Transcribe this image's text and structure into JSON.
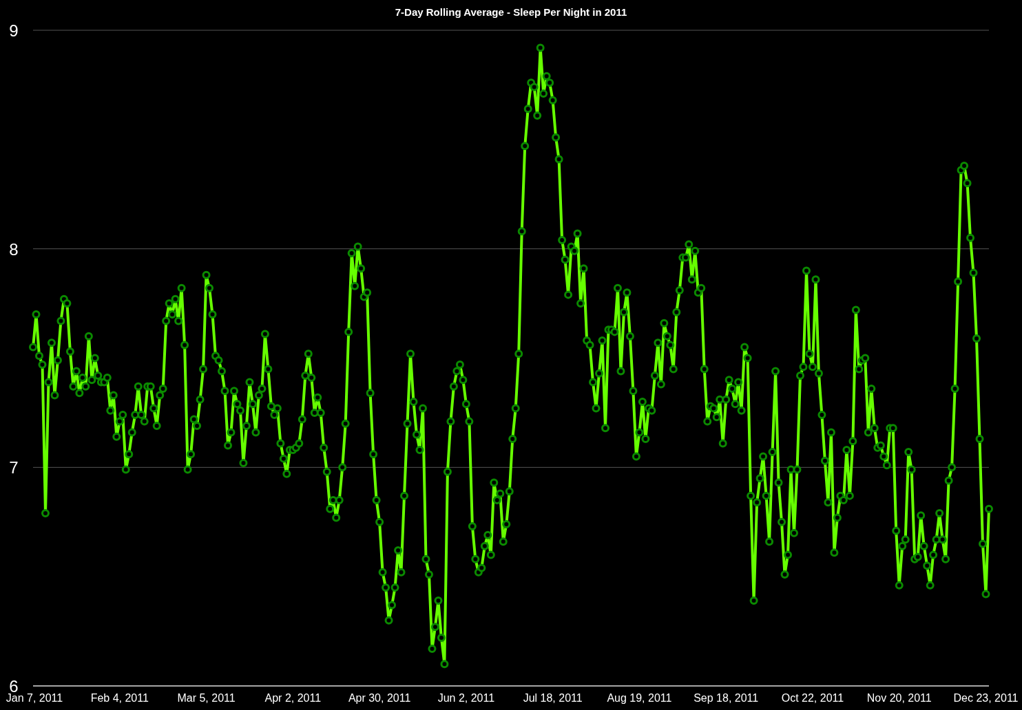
{
  "chart": {
    "chart_data": {
      "type": "line",
      "title": "7-Day Rolling Average - Sleep Per Night in 2011",
      "marker": "o",
      "ylim": [
        6,
        9
      ],
      "yticks": [
        6,
        7,
        8,
        9
      ],
      "categories": [
        "Jan 7, 2011",
        null,
        null,
        null,
        null,
        null,
        null,
        null,
        null,
        null,
        null,
        null,
        null,
        null,
        null,
        null,
        null,
        null,
        null,
        null,
        null,
        null,
        null,
        null,
        null,
        null,
        null,
        null,
        "Feb 4, 2011",
        null,
        null,
        null,
        null,
        null,
        null,
        null,
        null,
        null,
        null,
        null,
        null,
        null,
        null,
        null,
        null,
        null,
        null,
        null,
        null,
        null,
        null,
        null,
        null,
        null,
        null,
        null,
        "Mar 5, 2011",
        null,
        null,
        null,
        null,
        null,
        null,
        null,
        null,
        null,
        null,
        null,
        null,
        null,
        null,
        null,
        null,
        null,
        null,
        null,
        null,
        null,
        null,
        null,
        null,
        null,
        null,
        null,
        "Apr 2, 2011",
        null,
        null,
        null,
        null,
        null,
        null,
        null,
        null,
        null,
        null,
        null,
        null,
        null,
        null,
        null,
        null,
        null,
        null,
        null,
        null,
        null,
        null,
        null,
        null,
        null,
        null,
        null,
        "Apr 30, 2011",
        null,
        null,
        null,
        null,
        null,
        null,
        null,
        null,
        null,
        null,
        null,
        null,
        null,
        null,
        null,
        null,
        null,
        null,
        null,
        null,
        null,
        null,
        null,
        null,
        null,
        null,
        null,
        "Jun 2, 2011",
        null,
        null,
        null,
        null,
        null,
        null,
        null,
        null,
        null,
        null,
        null,
        null,
        null,
        null,
        null,
        null,
        null,
        null,
        null,
        null,
        null,
        null,
        null,
        null,
        null,
        null,
        null,
        "Jul 18, 2011",
        null,
        null,
        null,
        null,
        null,
        null,
        null,
        null,
        null,
        null,
        null,
        null,
        null,
        null,
        null,
        null,
        null,
        null,
        null,
        null,
        null,
        null,
        null,
        null,
        null,
        null,
        null,
        "Aug 19, 2011",
        null,
        null,
        null,
        null,
        null,
        null,
        null,
        null,
        null,
        null,
        null,
        null,
        null,
        null,
        null,
        null,
        null,
        null,
        null,
        null,
        null,
        null,
        null,
        null,
        null,
        null,
        null,
        "Sep 18, 2011",
        null,
        null,
        null,
        null,
        null,
        null,
        null,
        null,
        null,
        null,
        null,
        null,
        null,
        null,
        null,
        null,
        null,
        null,
        null,
        null,
        null,
        null,
        null,
        null,
        null,
        null,
        null,
        "Oct 22, 2011",
        null,
        null,
        null,
        null,
        null,
        null,
        null,
        null,
        null,
        null,
        null,
        null,
        null,
        null,
        null,
        null,
        null,
        null,
        null,
        null,
        null,
        null,
        null,
        null,
        null,
        null,
        null,
        "Nov 20, 2011",
        null,
        null,
        null,
        null,
        null,
        null,
        null,
        null,
        null,
        null,
        null,
        null,
        null,
        null,
        null,
        null,
        null,
        null,
        null,
        null,
        null,
        null,
        null,
        null,
        null,
        null,
        null,
        "Dec 23, 2011",
        null
      ],
      "values": [
        7.55,
        7.7,
        7.51,
        7.47,
        6.79,
        7.39,
        7.57,
        7.33,
        7.49,
        7.67,
        7.77,
        7.75,
        7.53,
        7.37,
        7.44,
        7.34,
        7.41,
        7.37,
        7.6,
        7.4,
        7.5,
        7.42,
        7.39,
        7.39,
        7.41,
        7.26,
        7.33,
        7.14,
        7.21,
        7.24,
        6.99,
        7.06,
        7.16,
        7.24,
        7.37,
        7.24,
        7.21,
        7.37,
        7.37,
        7.27,
        7.19,
        7.33,
        7.36,
        7.67,
        7.75,
        7.7,
        7.77,
        7.67,
        7.82,
        7.56,
        6.99,
        7.06,
        7.22,
        7.19,
        7.31,
        7.45,
        7.88,
        7.82,
        7.7,
        7.51,
        7.49,
        7.44,
        7.35,
        7.1,
        7.16,
        7.35,
        7.29,
        7.26,
        7.02,
        7.19,
        7.39,
        7.29,
        7.16,
        7.33,
        7.36,
        7.61,
        7.45,
        7.28,
        7.24,
        7.27,
        7.11,
        7.04,
        6.97,
        7.08,
        7.08,
        7.09,
        7.11,
        7.22,
        7.42,
        7.52,
        7.41,
        7.25,
        7.32,
        7.25,
        7.09,
        6.98,
        6.81,
        6.85,
        6.77,
        6.85,
        7.0,
        7.2,
        7.62,
        7.98,
        7.83,
        8.01,
        7.91,
        7.78,
        7.8,
        7.34,
        7.06,
        6.85,
        6.75,
        6.52,
        6.45,
        6.3,
        6.37,
        6.45,
        6.62,
        6.52,
        6.87,
        7.2,
        7.52,
        7.3,
        7.15,
        7.08,
        7.27,
        6.58,
        6.51,
        6.17,
        6.27,
        6.39,
        6.22,
        6.1,
        6.98,
        7.21,
        7.37,
        7.44,
        7.47,
        7.4,
        7.29,
        7.21,
        6.73,
        6.58,
        6.52,
        6.54,
        6.64,
        6.69,
        6.6,
        6.93,
        6.85,
        6.88,
        6.66,
        6.74,
        6.89,
        7.13,
        7.27,
        7.52,
        8.08,
        8.47,
        8.64,
        8.76,
        8.74,
        8.61,
        8.92,
        8.71,
        8.79,
        8.76,
        8.68,
        8.51,
        8.41,
        8.04,
        7.95,
        7.79,
        8.01,
        7.99,
        8.07,
        7.75,
        7.91,
        7.58,
        7.56,
        7.39,
        7.27,
        7.43,
        7.58,
        7.18,
        7.63,
        7.63,
        7.62,
        7.82,
        7.44,
        7.71,
        7.8,
        7.6,
        7.35,
        7.05,
        7.16,
        7.3,
        7.13,
        7.27,
        7.26,
        7.42,
        7.57,
        7.38,
        7.66,
        7.6,
        7.56,
        7.45,
        7.71,
        7.81,
        7.96,
        7.96,
        8.02,
        7.86,
        7.99,
        7.8,
        7.82,
        7.45,
        7.21,
        7.28,
        7.27,
        7.23,
        7.31,
        7.11,
        7.31,
        7.4,
        7.36,
        7.29,
        7.39,
        7.26,
        7.55,
        7.5,
        6.87,
        6.39,
        6.84,
        6.95,
        7.05,
        6.87,
        6.66,
        7.07,
        7.44,
        6.93,
        6.75,
        6.51,
        6.6,
        6.99,
        6.7,
        6.99,
        7.42,
        7.46,
        7.9,
        7.52,
        7.46,
        7.86,
        7.43,
        7.24,
        7.03,
        6.84,
        7.16,
        6.61,
        6.77,
        6.87,
        6.85,
        7.08,
        6.87,
        7.12,
        7.72,
        7.45,
        7.49,
        7.5,
        7.16,
        7.36,
        7.18,
        7.09,
        7.1,
        7.05,
        7.01,
        7.18,
        7.18,
        6.71,
        6.46,
        6.64,
        6.67,
        7.07,
        6.99,
        6.58,
        6.59,
        6.78,
        6.64,
        6.55,
        6.46,
        6.6,
        6.67,
        6.79,
        6.67,
        6.58,
        6.94,
        7.0,
        7.36,
        7.85,
        8.36,
        8.38,
        8.3,
        8.05,
        7.89,
        7.59,
        7.13,
        6.65,
        6.42,
        6.81
      ]
    }
  }
}
